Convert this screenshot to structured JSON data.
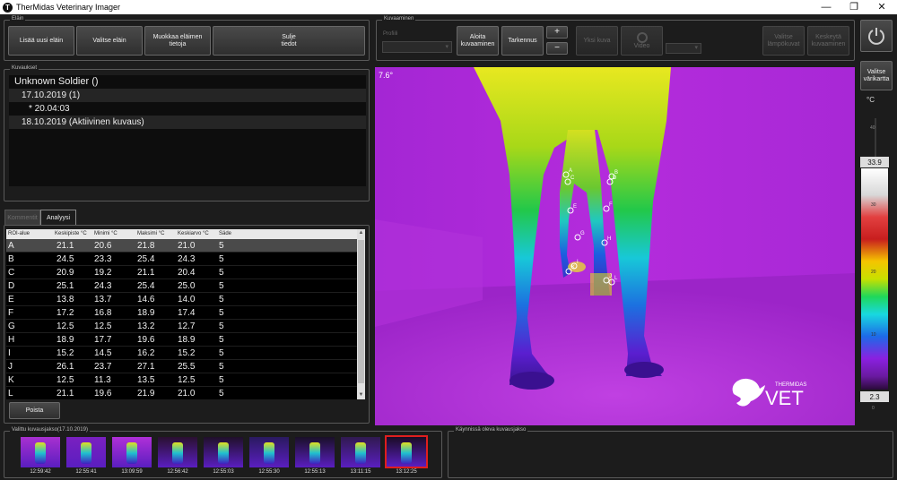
{
  "window": {
    "title": "TherMidas Veterinary Imager",
    "app_icon_glyph": "T",
    "min_glyph": "—",
    "max_glyph": "❐",
    "close_glyph": "✕"
  },
  "elain": {
    "group_label": "Eläin",
    "add_new": "Lisää uusi eläin",
    "choose": "Valitse eläin",
    "edit": "Muokkaa eläimen tietoja",
    "close": "Sulje tiedot"
  },
  "kuvaukset": {
    "group_label": "Kuvaukset",
    "items": [
      {
        "text": "Unknown Soldier ()"
      },
      {
        "text": "17.10.2019 (1)"
      },
      {
        "text": "* 20.04:03"
      },
      {
        "text": "18.10.2019 (Aktiivinen kuvaus)"
      }
    ]
  },
  "tabs": {
    "comments": "Kommentit",
    "analysis": "Analyysi"
  },
  "table": {
    "headers": [
      "ROI-alue",
      "Keskipiste °C",
      "Minimi °C",
      "Maksimi °C",
      "Keskiarvo °C",
      "Säde"
    ],
    "rows": [
      [
        "A",
        "21.1",
        "20.6",
        "21.8",
        "21.0",
        "5"
      ],
      [
        "B",
        "24.5",
        "23.3",
        "25.4",
        "24.3",
        "5"
      ],
      [
        "C",
        "20.9",
        "19.2",
        "21.1",
        "20.4",
        "5"
      ],
      [
        "D",
        "25.1",
        "24.3",
        "25.4",
        "25.0",
        "5"
      ],
      [
        "E",
        "13.8",
        "13.7",
        "14.6",
        "14.0",
        "5"
      ],
      [
        "F",
        "17.2",
        "16.8",
        "18.9",
        "17.4",
        "5"
      ],
      [
        "G",
        "12.5",
        "12.5",
        "13.2",
        "12.7",
        "5"
      ],
      [
        "H",
        "18.9",
        "17.7",
        "19.6",
        "18.9",
        "5"
      ],
      [
        "I",
        "15.2",
        "14.5",
        "16.2",
        "15.2",
        "5"
      ],
      [
        "J",
        "26.1",
        "23.7",
        "27.1",
        "25.5",
        "5"
      ],
      [
        "K",
        "12.5",
        "11.3",
        "13.5",
        "12.5",
        "5"
      ],
      [
        "L",
        "21.1",
        "19.6",
        "21.9",
        "21.0",
        "5"
      ]
    ],
    "delete_button": "Poista"
  },
  "kuvaaminen": {
    "group_label": "Kuvaaminen",
    "profile_label": "Profiili",
    "start": "Aloita kuvaaminen",
    "focus": "Tarkennus",
    "plus": "+",
    "minus": "−",
    "single_image": "Yksi kuva",
    "video": "Video",
    "choose_temp": "Valitse lämpökuvat",
    "stop": "Keskeytä kuvaaminen"
  },
  "colormap": {
    "button": "Valitse värikartta",
    "unit": "°C",
    "max_value": "33.9",
    "min_value": "2.3",
    "ticks": [
      "40",
      "30",
      "20",
      "10",
      "0"
    ]
  },
  "image": {
    "corner_temp": "7.6°",
    "logo_brand": "THERMIDAS",
    "logo_word": "VET",
    "roi_labels": [
      "A",
      "B",
      "C",
      "D",
      "E",
      "F",
      "G",
      "H",
      "I",
      "J",
      "K",
      "L"
    ]
  },
  "sequence": {
    "group_label": "Valittu kuvausjakso(17.10.2019)",
    "times": [
      "12:59:42",
      "12:55:41",
      "13:09:59",
      "12:56:42",
      "12:55:03",
      "12:55:30",
      "12:55:13",
      "13:11:15",
      "13:12:25"
    ]
  },
  "running": {
    "group_label": "Käynnissä oleva kuvausjakso"
  },
  "colors": {
    "background": "#1c1c1c",
    "thermal_bg": "#b12ad8",
    "selected_thumb_border": "#e01e1e"
  }
}
